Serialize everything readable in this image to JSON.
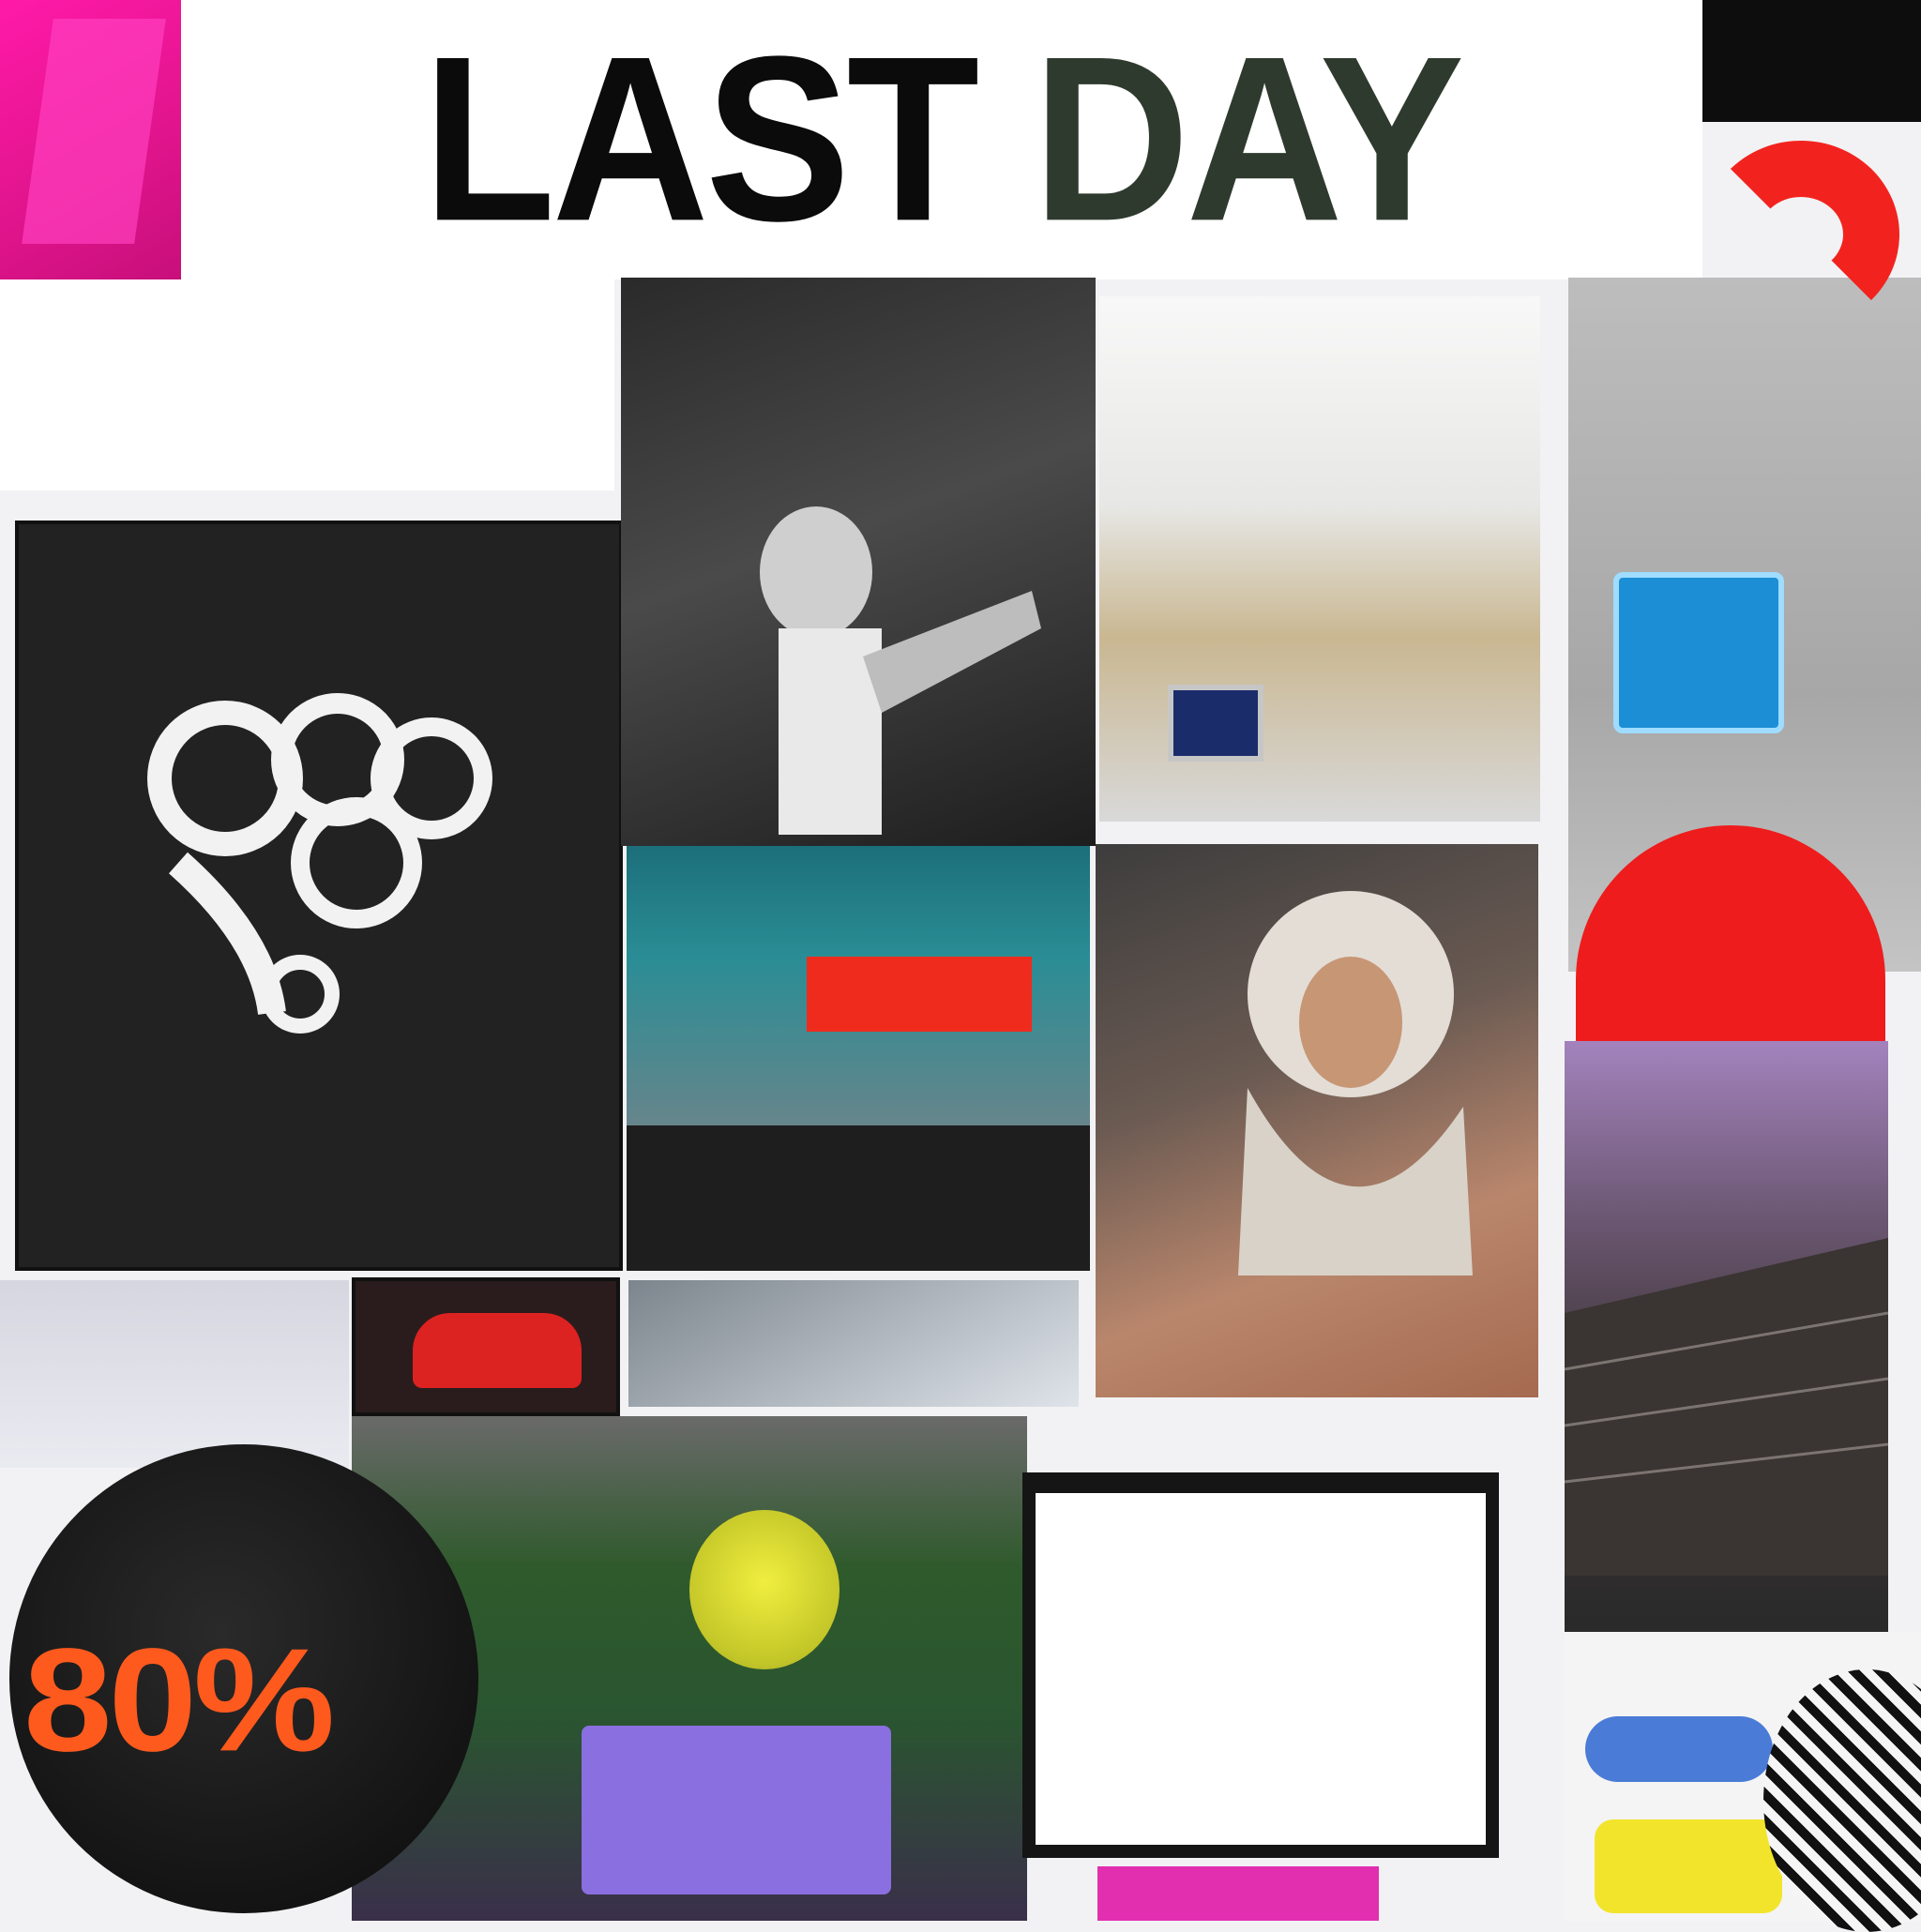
{
  "headline": {
    "word_1": "LAST",
    "word_2": "DAY"
  },
  "discount_badge": {
    "value": "80%"
  },
  "colors": {
    "headline_text": "#101010",
    "accent_pink": "#ff1aa8",
    "accent_red": "#f2231f",
    "discount_orange": "#ff5a1e"
  },
  "icons": [
    "red-arc-shape",
    "blue-sign-shape",
    "red-dome-shape",
    "yellow-sun-shape"
  ]
}
